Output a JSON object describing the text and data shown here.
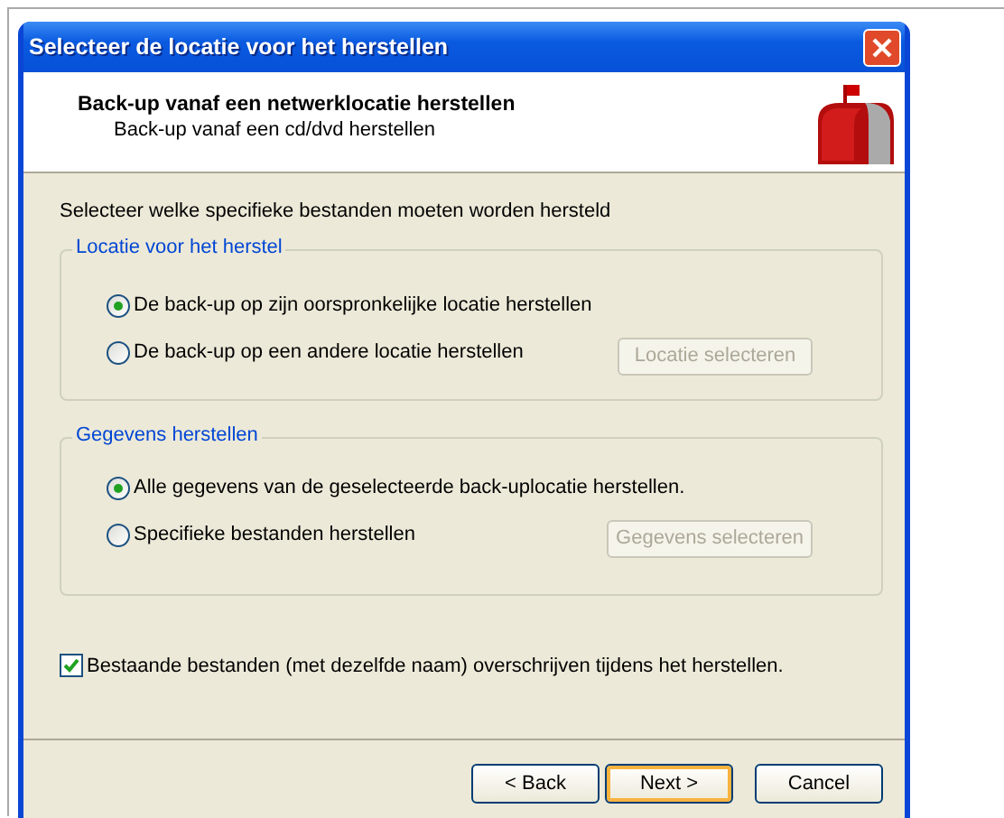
{
  "window": {
    "title": "Selecteer de locatie voor het herstellen"
  },
  "header": {
    "title": "Back-up vanaf een netwerklocatie herstellen",
    "subtitle": "Back-up vanaf een cd/dvd herstellen"
  },
  "instruction": "Selecteer welke specifieke bestanden moeten worden hersteld",
  "groups": [
    {
      "legend": "Locatie voor het herstel",
      "options": [
        {
          "label": "De back-up op zijn oorspronkelijke locatie herstellen",
          "selected": true
        },
        {
          "label": "De back-up op een andere locatie herstellen",
          "selected": false,
          "button": {
            "label": "Locatie selecteren",
            "disabled": true
          }
        }
      ]
    },
    {
      "legend": "Gegevens herstellen",
      "options": [
        {
          "label": "Alle gegevens van de geselecteerde back-uplocatie herstellen.",
          "selected": true
        },
        {
          "label": "Specifieke bestanden herstellen",
          "selected": false,
          "button": {
            "label": "Gegevens selecteren",
            "disabled": true
          }
        }
      ]
    }
  ],
  "overwrite": {
    "label": "Bestaande bestanden (met dezelfde naam) overschrijven tijdens het herstellen.",
    "checked": true
  },
  "buttons": [
    {
      "label": "< Back",
      "default": false
    },
    {
      "label": "Next >",
      "default": true
    },
    {
      "label": "Cancel",
      "default": false
    }
  ]
}
